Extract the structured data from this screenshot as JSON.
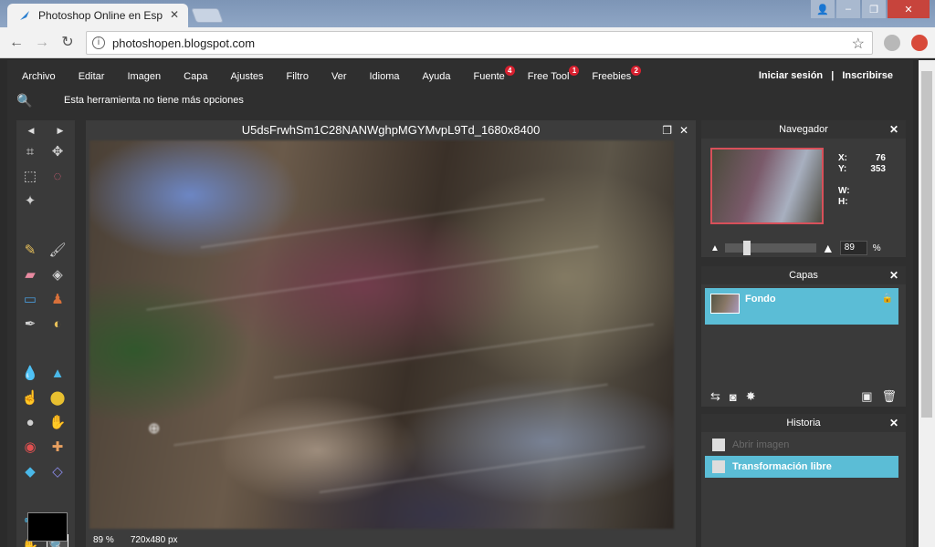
{
  "browser": {
    "tab_title": "Photoshop Online en Esp",
    "tab_close": "✕",
    "url": "photoshopen.blogspot.com",
    "back_icon": "arrow-left-icon",
    "forward_icon": "arrow-right-icon",
    "reload_icon": "reload-icon",
    "window_buttons": {
      "user": "👤",
      "min": "–",
      "max": "❐",
      "close": "✕"
    }
  },
  "menu": {
    "items": [
      {
        "label": "Archivo"
      },
      {
        "label": "Editar"
      },
      {
        "label": "Imagen"
      },
      {
        "label": "Capa"
      },
      {
        "label": "Ajustes"
      },
      {
        "label": "Filtro"
      },
      {
        "label": "Ver"
      },
      {
        "label": "Idioma"
      },
      {
        "label": "Ayuda"
      },
      {
        "label": "Fuente",
        "badge": "4"
      },
      {
        "label": "Free Tool",
        "badge": "1"
      },
      {
        "label": "Freebies",
        "badge": "2"
      }
    ],
    "login": "Iniciar sesión",
    "separator": "|",
    "signup": "Inscribirse"
  },
  "options_bar": {
    "text": "Esta herramienta no tiene más opciones"
  },
  "tools_panel": {
    "arrow_left": "◀",
    "arrow_right": "▶"
  },
  "document": {
    "title": "U5dsFrwhSm1C28NANWghpMGYMvpL9Td_1680x8400",
    "zoom": "89",
    "zoom_unit": "%",
    "size": "720x480 px"
  },
  "navigator": {
    "title": "Navegador",
    "x_label": "X:",
    "x_value": "76",
    "y_label": "Y:",
    "y_value": "353",
    "w_label": "W:",
    "h_label": "H:",
    "zoom_value": "89",
    "zoom_unit": "%"
  },
  "layers": {
    "title": "Capas",
    "items": [
      {
        "name": "Fondo"
      }
    ]
  },
  "history": {
    "title": "Historia",
    "items": [
      {
        "label": "Abrir imagen"
      },
      {
        "label": "Transformación libre"
      }
    ]
  },
  "colors": {
    "accent": "#5bbdd6",
    "badge": "#d8202f",
    "chrome_close": "#c7443c"
  }
}
